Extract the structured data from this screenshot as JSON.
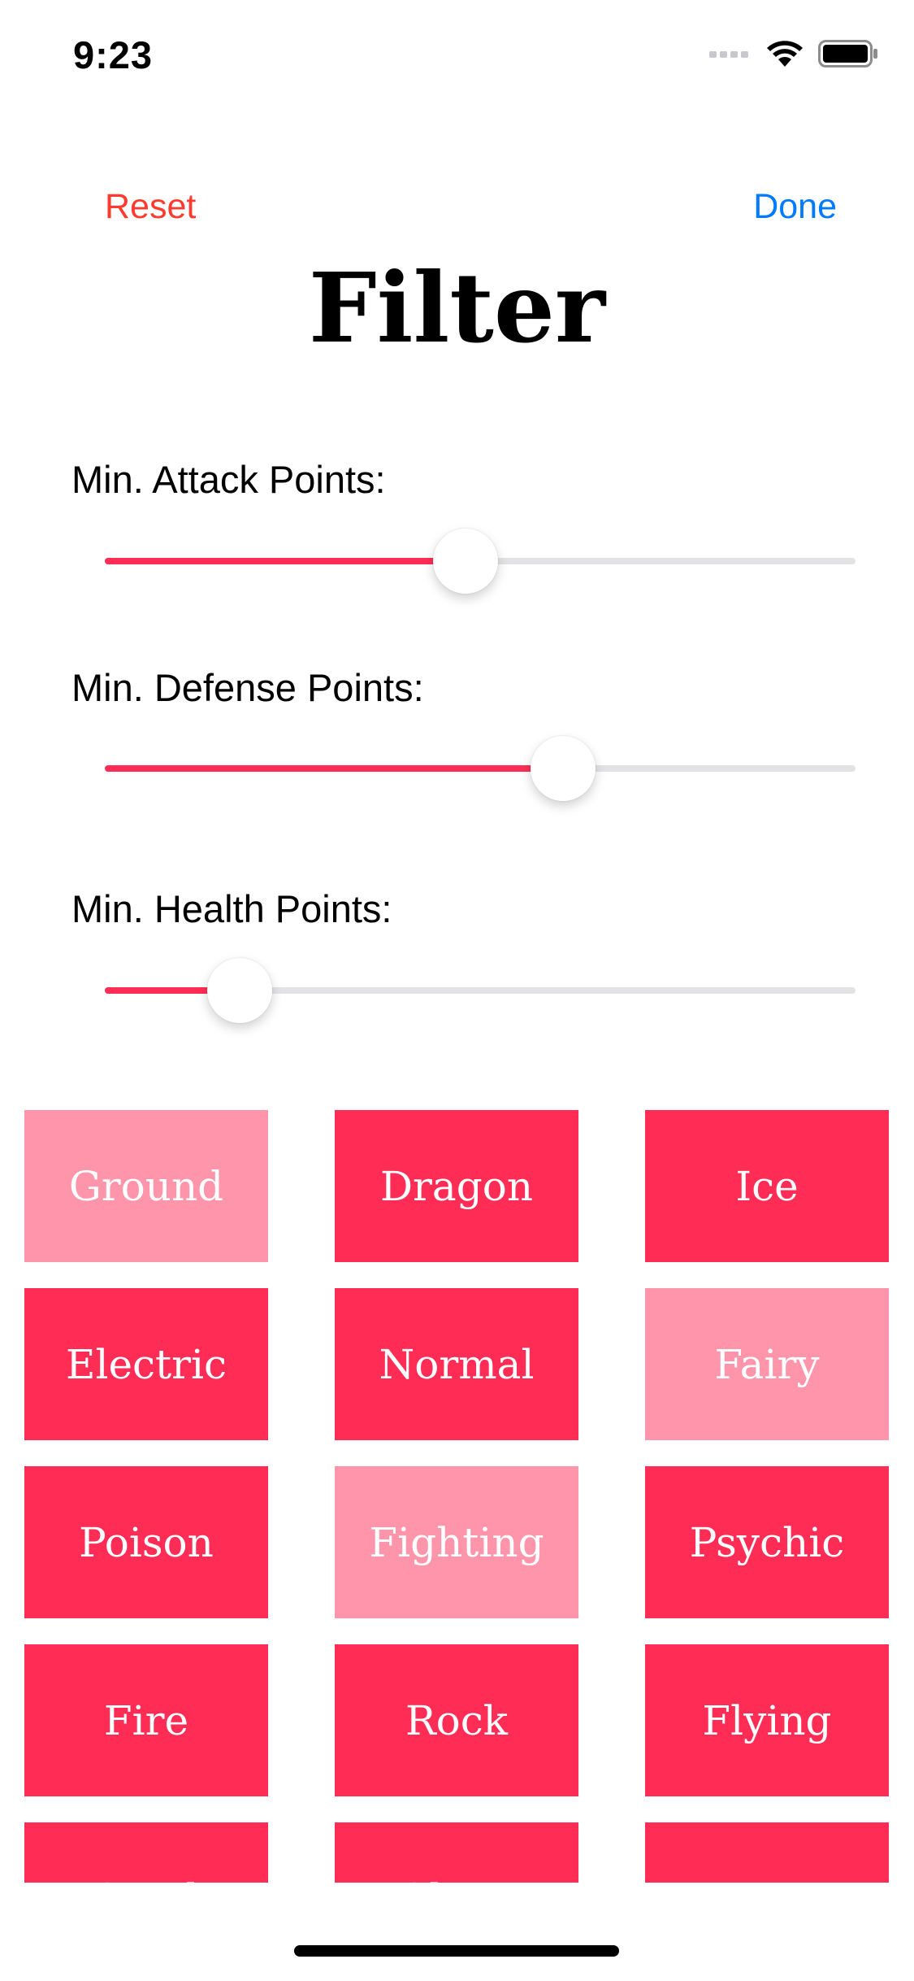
{
  "status_bar": {
    "time": "9:23"
  },
  "nav": {
    "reset_label": "Reset",
    "done_label": "Done",
    "reset_color": "#ff3b30",
    "done_color": "#007aff"
  },
  "title": "Filter",
  "sliders": [
    {
      "label": "Min. Attack Points:",
      "value_fraction": 0.48
    },
    {
      "label": "Min. Defense Points:",
      "value_fraction": 0.61
    },
    {
      "label": "Min. Health Points:",
      "value_fraction": 0.18
    }
  ],
  "colors": {
    "accent": "#ff2d55",
    "tile_active": "#ff2d55",
    "tile_inactive": "#ff95aa",
    "slider_track": "#e3e3e6"
  },
  "types": [
    {
      "label": "Ground",
      "selected": false
    },
    {
      "label": "Dragon",
      "selected": true
    },
    {
      "label": "Ice",
      "selected": true
    },
    {
      "label": "Electric",
      "selected": true
    },
    {
      "label": "Normal",
      "selected": true
    },
    {
      "label": "Fairy",
      "selected": false
    },
    {
      "label": "Poison",
      "selected": true
    },
    {
      "label": "Fighting",
      "selected": false
    },
    {
      "label": "Psychic",
      "selected": true
    },
    {
      "label": "Fire",
      "selected": true
    },
    {
      "label": "Rock",
      "selected": true
    },
    {
      "label": "Flying",
      "selected": true
    },
    {
      "label": "Steel",
      "selected": true
    },
    {
      "label": "Ghost",
      "selected": true
    },
    {
      "label": "Water",
      "selected": true
    }
  ]
}
